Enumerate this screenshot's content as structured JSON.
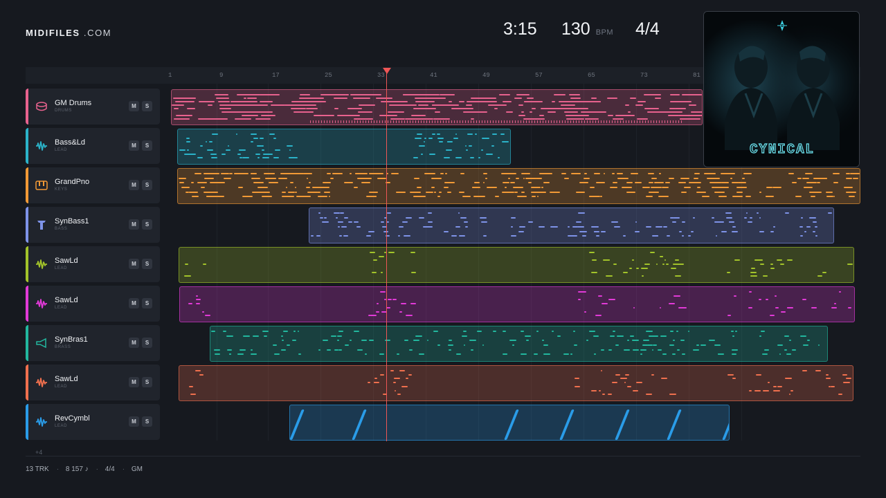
{
  "brand": {
    "name": "MIDIFILES",
    "domain": " .COM"
  },
  "transport": {
    "time": "3:15",
    "bpm": "130",
    "bpm_label": "BPM",
    "signature": "4/4"
  },
  "ruler": [
    "1",
    "9",
    "17",
    "25",
    "33",
    "41",
    "49",
    "57",
    "65",
    "73",
    "81"
  ],
  "tracks": [
    {
      "name": "GM Drums",
      "category": "DRUMS",
      "color": "#e8628e",
      "icon": "drum-icon",
      "mute": "M",
      "solo": "S"
    },
    {
      "name": "Bass&Ld",
      "category": "LEAD",
      "color": "#2bb3c9",
      "icon": "wave-icon",
      "mute": "M",
      "solo": "S"
    },
    {
      "name": "GrandPno",
      "category": "KEYS",
      "color": "#f29a36",
      "icon": "piano-icon",
      "mute": "M",
      "solo": "S"
    },
    {
      "name": "SynBass1",
      "category": "BASS",
      "color": "#7e93e8",
      "icon": "bass-icon",
      "mute": "M",
      "solo": "S"
    },
    {
      "name": "SawLd",
      "category": "LEAD",
      "color": "#a3c42a",
      "icon": "wave-icon",
      "mute": "M",
      "solo": "S"
    },
    {
      "name": "SawLd",
      "category": "LEAD",
      "color": "#e23ad8",
      "icon": "wave-icon",
      "mute": "M",
      "solo": "S"
    },
    {
      "name": "SynBras1",
      "category": "BRASS",
      "color": "#22b79e",
      "icon": "horn-icon",
      "mute": "M",
      "solo": "S"
    },
    {
      "name": "SawLd",
      "category": "LEAD",
      "color": "#f0704e",
      "icon": "wave-icon",
      "mute": "M",
      "solo": "S"
    },
    {
      "name": "RevCymbl",
      "category": "LEAD",
      "color": "#2a9ce8",
      "icon": "wave-icon",
      "mute": "M",
      "solo": "S"
    }
  ],
  "more_tracks": "+4",
  "footer": {
    "tracks": "13 TRK",
    "notes": "8 157 ♪",
    "signature": "4/4",
    "standard": "GM"
  },
  "cover": {
    "title": "CYNICAL"
  }
}
